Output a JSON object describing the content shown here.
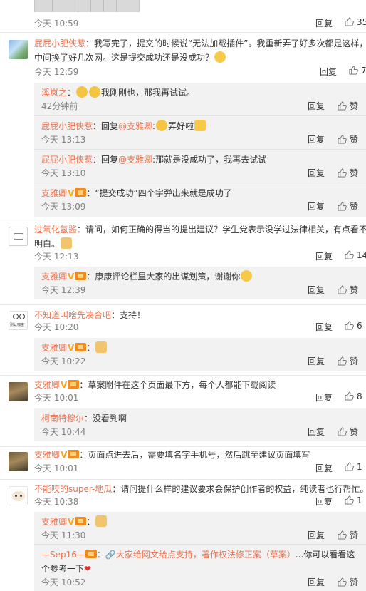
{
  "labels": {
    "reply": "回复",
    "like": "赞"
  },
  "colors": {
    "name": "#eb7350",
    "meta": "#808080",
    "sub_bg": "#f2f2f2"
  },
  "comments": [
    {
      "time": "今天 10:59",
      "likes": "35"
    },
    {
      "name": "屁屁小肥侠惹",
      "text_line1": "：我写完了，提交的时候说“无法加载插件”。我重新弄了好多次都是这样，",
      "text_line2": "中间换了好几次网。这是提交成功还是没成功？",
      "emoji": "thinking-emoji",
      "time": "今天 12:59",
      "likes": "7",
      "replies": [
        {
          "name": "溪岚之",
          "sep": "：",
          "emoji": "cry-emoji",
          "text": "我刚刚也，那我再试试。",
          "time": "42分钟前"
        },
        {
          "name": "屁屁小肥侠惹",
          "sep": "：回复",
          "mention": "@支雅卿",
          "text": ":",
          "emoji": "cry-emoji",
          "text2": "弄好啦",
          "emoji2": "victory-hand-emoji",
          "time": "今天 13:13"
        },
        {
          "name": "屁屁小肥侠惹",
          "sep": "：回复",
          "mention": "@支雅卿",
          "text": ":那就是没成功了，我再去试试",
          "time": "今天 13:10"
        },
        {
          "name": "支雅卿",
          "sep": "：",
          "text": "“提交成功”四个字弹出来就是成功了",
          "time": "今天 13:09"
        }
      ]
    },
    {
      "name": "过氧化氢酱",
      "text_line1": "：请问，如何正确的得当的提出建议？学生党表示没学过法律相关，有点看不",
      "text_line2": "明白。",
      "emoji": "bow-hands-emoji",
      "time": "今天 12:13",
      "likes": "14",
      "replies": [
        {
          "name": "支雅卿",
          "sep": "：",
          "text": "康康评论栏里大家的出谋划策，谢谢你",
          "emoji": "smile-emoji",
          "time": "今天 12:39"
        }
      ]
    },
    {
      "name": "不知道叫啥先凑合吧",
      "text_line1": "：支持！",
      "avatar_text": "别认咖宙",
      "time": "今天 10:20",
      "likes": "6",
      "replies": [
        {
          "name": "支雅卿",
          "sep": "：",
          "emoji": "bow-hands-emoji",
          "time": "今天 10:22"
        }
      ]
    },
    {
      "name": "支雅卿",
      "text_line1": "：草案附件在这个页面最下方，每个人都能下载阅读",
      "time": "今天 10:01",
      "likes": "8",
      "replies": [
        {
          "name": "柯南特穆尔",
          "sep": "：",
          "text": "没看到啊",
          "time": "今天 10:44"
        }
      ]
    },
    {
      "name": "支雅卿",
      "text_line1": "：页面点进去后，需要填名字手机号，然后跳至建议页面填写",
      "time": "今天 10:01",
      "likes": "1"
    },
    {
      "name": "不能咬的super-地瓜",
      "text_line1": "：请问提什么样的建议要求会保护创作者的权益，纯读者也行帮忙。",
      "time": "今天 10:38",
      "likes": "1",
      "replies": [
        {
          "name": "支雅卿",
          "sep": "：",
          "emoji": "bow-hands-emoji",
          "time": "今天 11:30"
        },
        {
          "name": "—Sep16—",
          "sep": "：",
          "link_icon": "link-icon",
          "link_text": "大家给网文给点支持，著作权法修正案（草案）",
          "text": "...你可以看看这",
          "text_line2": "个参考一下",
          "emoji": "heart-emoji",
          "time": "今天 10:52"
        }
      ]
    }
  ]
}
